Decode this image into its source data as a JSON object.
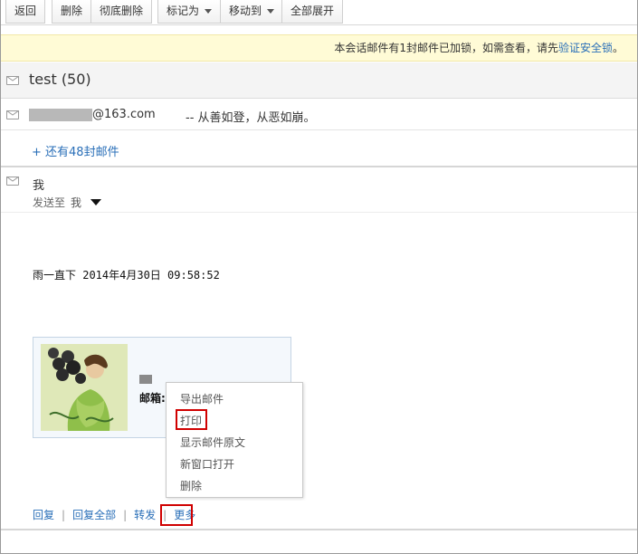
{
  "toolbar": {
    "back": "返回",
    "delete": "删除",
    "delete_forever": "彻底删除",
    "mark_as": "标记为",
    "move_to": "移动到",
    "expand_all": "全部展开"
  },
  "banner": {
    "text": "本会话邮件有1封邮件已加锁，如需查看，请先",
    "link": "验证安全锁",
    "tail": "。"
  },
  "thread": {
    "title": "test (50)"
  },
  "collapsed_mail": {
    "address": "@163.com",
    "snippet": "-- 从善如登，从恶如崩。"
  },
  "more_mails": "+ 还有48封邮件",
  "open_mail": {
    "sender": "我",
    "send_to_label": "发送至",
    "send_to_value": "我",
    "body_line": "雨一直下 2014年4月30日 09:58:52",
    "signature_mail_label": "邮箱:"
  },
  "context_menu": {
    "items": [
      "导出邮件",
      "打印",
      "显示邮件原文",
      "新窗口打开",
      "删除"
    ]
  },
  "actions": {
    "reply": "回复",
    "reply_all": "回复全部",
    "forward": "转发",
    "more": "更多"
  },
  "colors": {
    "link": "#2a6fb8",
    "banner_bg": "#fffbd6",
    "highlight": "#d00000"
  }
}
